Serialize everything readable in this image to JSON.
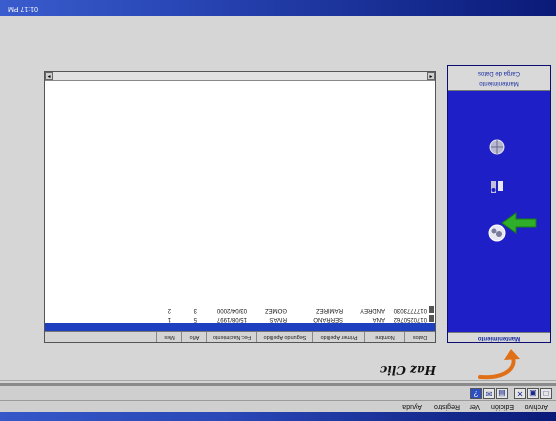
{
  "status_bar": {
    "clock": "01:17 PM"
  },
  "menu": {
    "items": [
      "Archivo",
      "Edición",
      "Ver",
      "Registro",
      "Ayuda"
    ]
  },
  "hint": {
    "text": "Haz Clic"
  },
  "left_panel": {
    "header": "Mantenimiento",
    "footer_line1": "Mantenimiento",
    "footer_line2": "Carga de Datos",
    "colors": {
      "panel": "#1f1fc8",
      "arrow": "#2fae2a",
      "curved_arrow": "#e07018"
    }
  },
  "grid": {
    "tabs": [
      "Datos",
      "Nombre",
      "Primer Apellido",
      "Segundo Apellido",
      "Fec.Nacimiento",
      "Año",
      "Mes"
    ],
    "rows": [
      [
        "0170250762",
        "ANA",
        "SERRANO",
        "RIVAS",
        "15/08/1997",
        "5",
        "1"
      ],
      [
        "0177773030",
        "ANDREY",
        "RAMIREZ",
        "GOMEZ",
        "03/04/2000",
        "3",
        "2"
      ]
    ]
  }
}
